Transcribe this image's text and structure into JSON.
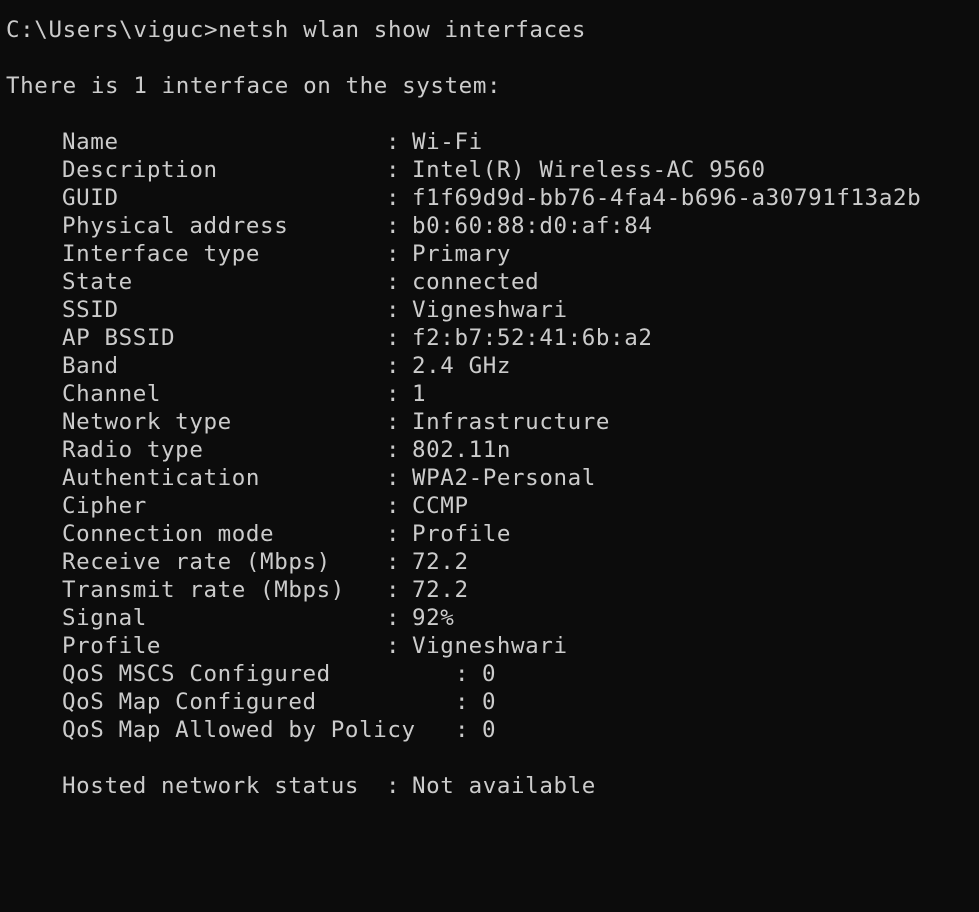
{
  "command_line": {
    "prompt": "C:\\Users\\viguc>",
    "command": "netsh wlan show interfaces"
  },
  "summary": "There is 1 interface on the system:",
  "separator": ":",
  "interface": {
    "name_label": "Name",
    "name": "Wi-Fi",
    "description_label": "Description",
    "description": "Intel(R) Wireless-AC 9560",
    "guid_label": "GUID",
    "guid": "f1f69d9d-bb76-4fa4-b696-a30791f13a2b",
    "physical_address_label": "Physical address",
    "physical_address": "b0:60:88:d0:af:84",
    "interface_type_label": "Interface type",
    "interface_type": "Primary",
    "state_label": "State",
    "state": "connected",
    "ssid_label": "SSID",
    "ssid": "Vigneshwari",
    "ap_bssid_label": "AP BSSID",
    "ap_bssid": "f2:b7:52:41:6b:a2",
    "band_label": "Band",
    "band": "2.4 GHz",
    "channel_label": "Channel",
    "channel": "1",
    "network_type_label": "Network type",
    "network_type": "Infrastructure",
    "radio_type_label": "Radio type",
    "radio_type": "802.11n",
    "authentication_label": "Authentication",
    "authentication": "WPA2-Personal",
    "cipher_label": "Cipher",
    "cipher": "CCMP",
    "connection_mode_label": "Connection mode",
    "connection_mode": "Profile",
    "receive_rate_label": "Receive rate (Mbps)",
    "receive_rate": "72.2",
    "transmit_rate_label": "Transmit rate (Mbps)",
    "transmit_rate": "72.2",
    "signal_label": "Signal",
    "signal": "92%",
    "profile_label": "Profile",
    "profile": "Vigneshwari",
    "qos_mscs_label": "QoS MSCS Configured",
    "qos_mscs": "0",
    "qos_map_label": "QoS Map Configured",
    "qos_map": "0",
    "qos_map_policy_label": "QoS Map Allowed by Policy",
    "qos_map_policy": "0"
  },
  "hosted_network": {
    "label": "Hosted network status",
    "value": "Not available"
  },
  "colors": {
    "background": "#0c0c0c",
    "foreground": "#cccccc"
  }
}
